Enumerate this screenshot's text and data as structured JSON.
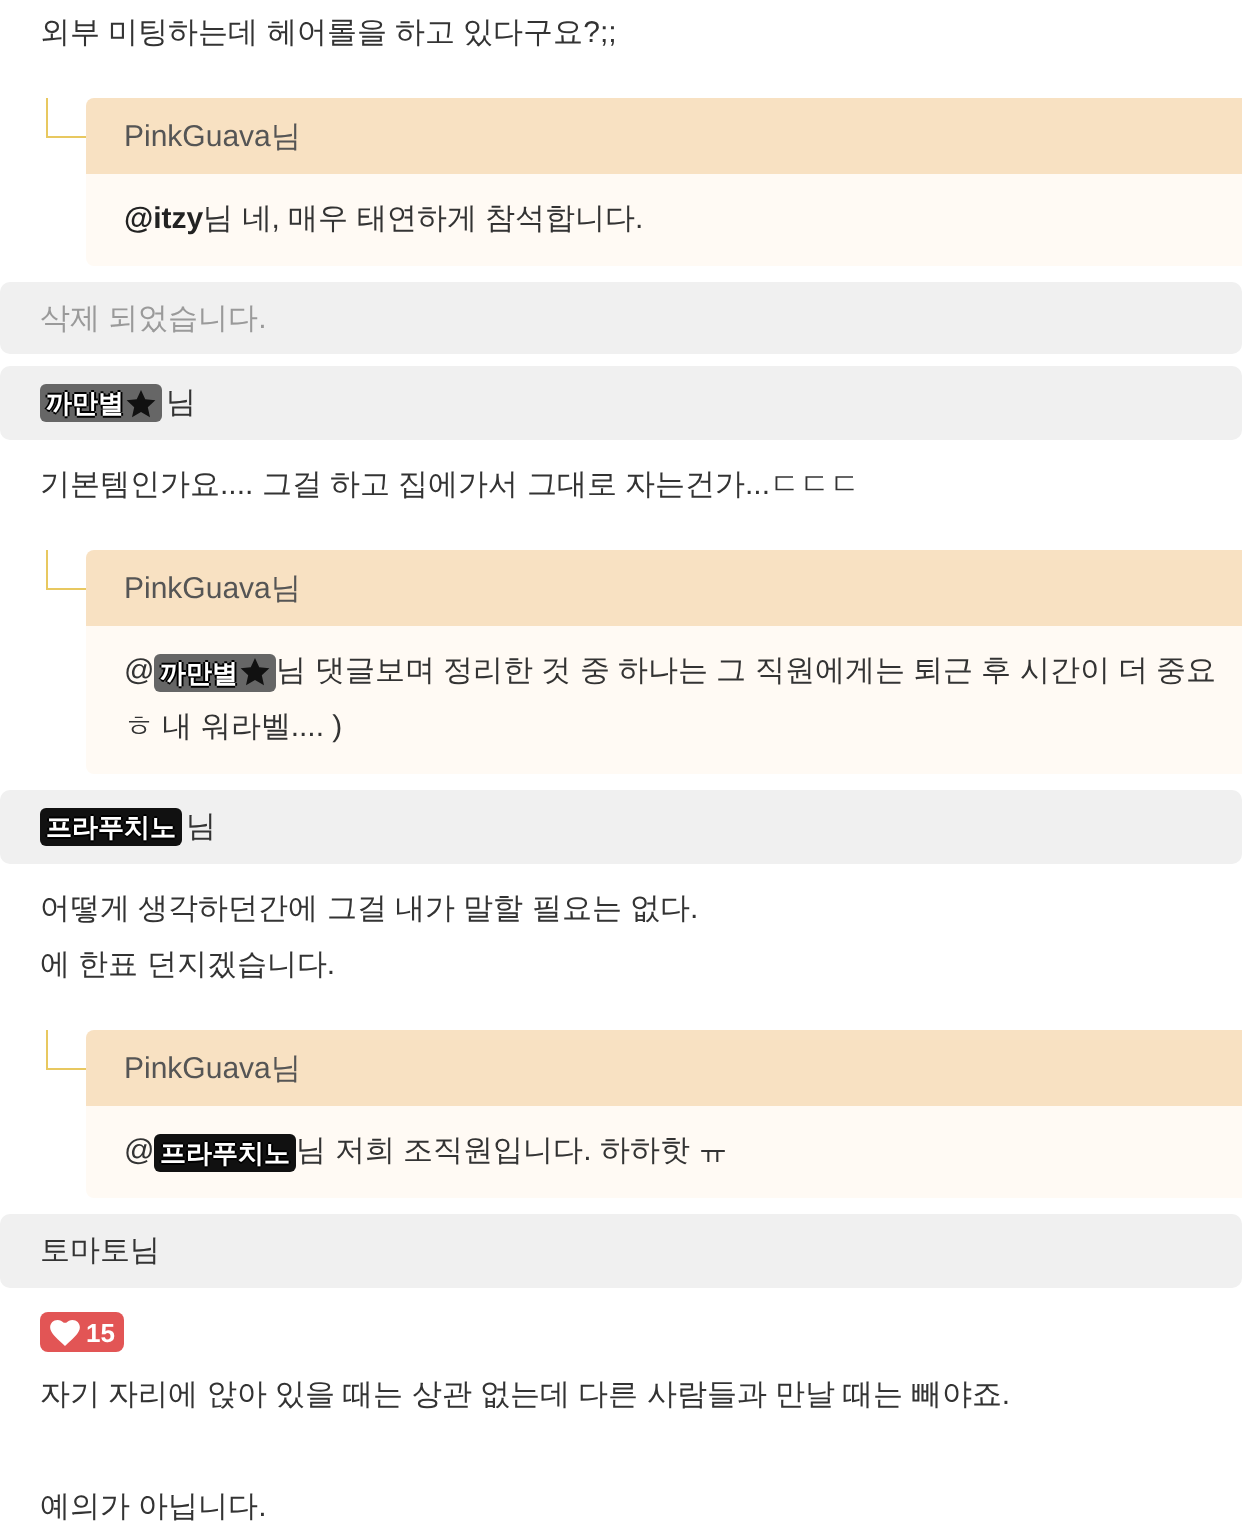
{
  "comments": [
    {
      "kind": "comment",
      "body": [
        [
          "외부 미팅하는데 헤어롤을 하고 있다구요?;;"
        ]
      ],
      "replies": [
        {
          "author": "PinkGuava님",
          "lines": [
            [
              {
                "kind": "text",
                "text": "**@itzy**님 네, 매우 태연하게 참석합니다."
              }
            ]
          ]
        }
      ]
    },
    {
      "kind": "deleted",
      "notice": "삭제 되었습니다."
    },
    {
      "kind": "comment",
      "header": [
        {
          "kind": "badge",
          "name": "까만별",
          "color": "#666666",
          "star": true
        },
        {
          "kind": "suffix",
          "text": "님"
        }
      ],
      "body": [
        [
          "기본템인가요.... 그걸 하고 집에가서 그대로 자는건가...ㄷㄷㄷ"
        ]
      ],
      "replies": [
        {
          "author": "PinkGuava님",
          "lines": [
            [
              {
                "kind": "text",
                "text": "@"
              },
              {
                "kind": "badge",
                "name": "까만별",
                "color": "#666666",
                "star": true
              },
              {
                "kind": "text",
                "text": "님 댓글보며 정리한 것 중 하나는 그 직원에게는 퇴근 후 시간이 더 중요"
              }
            ],
            [
              {
                "kind": "text",
                "text": "ㅎ 내 워라벨.... )"
              }
            ]
          ]
        }
      ]
    },
    {
      "kind": "comment",
      "header": [
        {
          "kind": "badge",
          "name": "프라푸치노",
          "color": "#111111"
        },
        {
          "kind": "suffix",
          "text": "님"
        }
      ],
      "body": [
        [
          "어떻게 생각하던간에 그걸 내가 말할 필요는 없다.",
          "에 한표 던지겠습니다."
        ]
      ],
      "replies": [
        {
          "author": "PinkGuava님",
          "lines": [
            [
              {
                "kind": "text",
                "text": "@"
              },
              {
                "kind": "badge",
                "name": "프라푸치노",
                "color": "#111111"
              },
              {
                "kind": "text",
                "text": "님 저희 조직원입니다. 하하핫 ㅠ"
              }
            ]
          ]
        }
      ]
    },
    {
      "kind": "comment",
      "header": [
        {
          "kind": "text",
          "text": "토마토님"
        }
      ],
      "likes": "15",
      "body": [
        [
          "자기 자리에 앉아 있을 때는 상관 없는데 다른 사람들과 만날 때는 빼야죠."
        ],
        [
          "예의가 아닙니다."
        ]
      ]
    }
  ]
}
